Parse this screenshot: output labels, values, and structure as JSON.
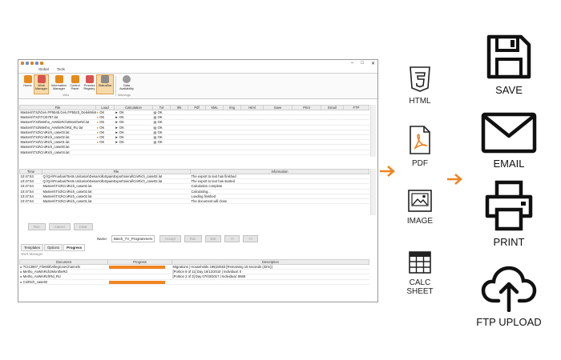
{
  "menubar": [
    "Global",
    "Tools"
  ],
  "ribbon": {
    "buttons": [
      {
        "label": "Home"
      },
      {
        "label": "Work Manager",
        "selected": true
      },
      {
        "label": "Information Manager"
      },
      {
        "label": "Control Panel"
      },
      {
        "label": "Process Registry"
      },
      {
        "label": "StatusBar",
        "selected": true
      },
      {
        "label": "Data Availability"
      }
    ],
    "groups": [
      "View",
      "Warnings"
    ]
  },
  "top_table": {
    "columns": [
      "File",
      "Load",
      "Calculation",
      "Txt",
      "Xls",
      "Pdf",
      "XML",
      "Img",
      "Html",
      "Save",
      "Print",
      "Email",
      "FTP"
    ],
    "rows": [
      {
        "file": "Masters\\TS2\\Gen.FP5545.Gen.FP5523_DelekWinBull",
        "load": "OK",
        "calc": "OK",
        "txt": "OK"
      },
      {
        "file": "Masters\\TS2\\TCI5787.lat",
        "load": "OK",
        "calc": "OK",
        "txt": "OK"
      },
      {
        "file": "Masters\\TS3\\Metho_AvWinRch2MontheRd.lat",
        "load": "OK",
        "calc": "OK",
        "txt": "OK"
      },
      {
        "file": "Masters\\TS3\\Metho_AvWinRchRd_RU.lat",
        "load": "OK",
        "calc": "OK",
        "txt": "OK"
      },
      {
        "file": "Masters\\TS3\\CniRich_case03.lat",
        "load": "OK",
        "calc": "OK",
        "txt": "OK"
      },
      {
        "file": "Masters\\TS3\\CniRich_case02.lat",
        "load": "OK",
        "calc": "OK",
        "txt": "OK"
      },
      {
        "file": "Masters\\TS3\\CniRich_case01.lat",
        "load": "OK",
        "calc": "OK",
        "txt": "OK"
      },
      {
        "file": "Masters\\TS3\\CniRich_case00.lat",
        "load": "",
        "calc": "",
        "txt": ""
      },
      {
        "file": "Masters\\TS3\\CniRich_case04.lat",
        "load": "",
        "calc": "",
        "txt": ""
      }
    ]
  },
  "log_table": {
    "columns": [
      "Time",
      "File",
      "Information"
    ],
    "rows": [
      {
        "time": "10:47:53",
        "file": "Q:\\QA\\Pruebas\\Tests Unitarios\\DesarrolloSpainExport\\nieral\\CniRich_case02.lat",
        "info": "The export to text has finished"
      },
      {
        "time": "10:47:53",
        "file": "Q:\\QA\\Pruebas\\Tests Unitarios\\DesarrolloSpainExport\\nieral\\CniRich_case02.lat",
        "info": "The export to text has started"
      },
      {
        "time": "10:47:54",
        "file": "Masters\\TS3\\CniRich_case02.lat",
        "info": "Calculation complete"
      },
      {
        "time": "10:47:54",
        "file": "Masters\\TS3\\CniRich_case02.lat",
        "info": "Calculating..."
      },
      {
        "time": "10:47:54",
        "file": "Masters\\TS3\\CniRich_case02.lat",
        "info": "Loading finished"
      },
      {
        "time": "10:47:54",
        "file": "Masters\\TS3\\CniRich_case01.lat",
        "info": "The document will close"
      }
    ]
  },
  "run_buttons": [
    "Run",
    "Cancel",
    "Clear"
  ],
  "name_row": {
    "label": "Name:",
    "value": "Batch_TV_Programmers",
    "buttons": [
      "Accept",
      "Run",
      "Exit"
    ]
  },
  "tabs": [
    "Templates",
    "Options",
    "Progress"
  ],
  "work_manager": {
    "title": "Work Manager",
    "columns": [
      "Document",
      "Progress",
      "Description"
    ],
    "rows": [
      {
        "doc": "TCI13807_FileWithAllegroneChannels",
        "progress": 1.0,
        "desc": "Migrations | Households 195|24553 [Remaining 15 seconds (32%)]"
      },
      {
        "doc": "Metho_AvWinRch2MontheRd",
        "progress": 0.0,
        "desc": "[Portion 8 of 11] Day 16/12/2010 | Individual: 0"
      },
      {
        "doc": "Metho_AvWinRchRd_RU",
        "progress": 0.0,
        "desc": "[Portion 2 of 3] Day 07/03/2017 | Individual: 8669"
      },
      {
        "doc": "CniRich_case02",
        "progress": 1.0,
        "desc": ""
      }
    ]
  },
  "formats": [
    {
      "label": "HTML",
      "icon": "html5-icon"
    },
    {
      "label": "PDF",
      "icon": "pdf-file-icon"
    },
    {
      "label": "IMAGE",
      "icon": "image-icon"
    },
    {
      "label": "CALC\nSHEET",
      "line1": "CALC",
      "line2": "SHEET",
      "icon": "spreadsheet-icon"
    }
  ],
  "outputs": [
    {
      "label": "SAVE",
      "icon": "floppy-disk-icon"
    },
    {
      "label": "EMAIL",
      "icon": "envelope-icon"
    },
    {
      "label": "PRINT",
      "icon": "printer-icon"
    },
    {
      "label": "FTP UPLOAD",
      "icon": "cloud-upload-icon"
    }
  ],
  "colors": {
    "accent": "#f08420",
    "icon_dark": "#111111"
  }
}
